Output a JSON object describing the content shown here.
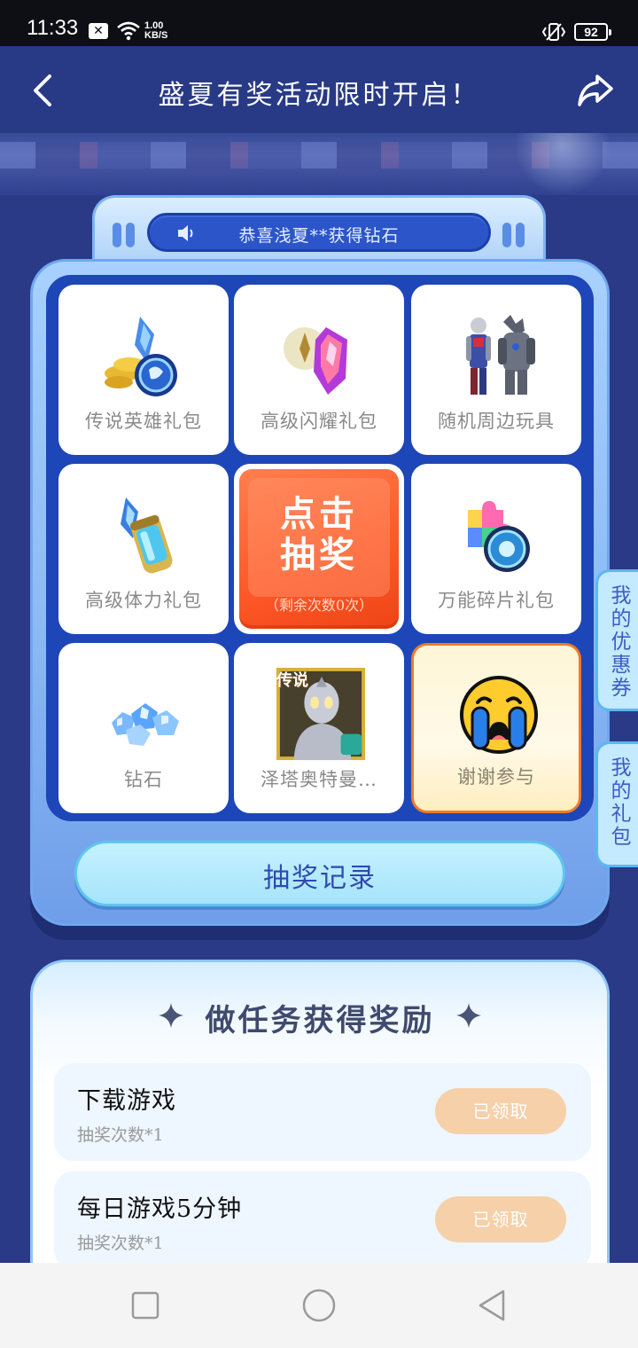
{
  "status_bar": {
    "time": "11:33",
    "net_speed_value": "1.00",
    "net_speed_unit": "KB/S",
    "battery": "92"
  },
  "header": {
    "title": "盛夏有奖活动限时开启！"
  },
  "notice": {
    "text": "恭喜浅夏**获得钻石"
  },
  "prizes": [
    {
      "label": "传说英雄礼包",
      "icon": "legend-hero-pack-icon"
    },
    {
      "label": "高级闪耀礼包",
      "icon": "shine-crystal-pack-icon"
    },
    {
      "label": "随机周边玩具",
      "icon": "figure-toys-icon"
    },
    {
      "label": "高级体力礼包",
      "icon": "energy-canister-icon"
    },
    {
      "label": "万能碎片礼包",
      "icon": "puzzle-fragment-icon"
    },
    {
      "label": "钻石",
      "icon": "diamond-pile-icon"
    },
    {
      "label": "泽塔奥特曼…",
      "icon": "zeta-ultraman-card-icon",
      "badge": "传说"
    },
    {
      "label": "谢谢参与",
      "icon": "crying-face-icon"
    }
  ],
  "draw_button": {
    "line1": "点击",
    "line2": "抽奖",
    "remaining": "（剩余次数0次）"
  },
  "records_button": {
    "label": "抽奖记录"
  },
  "side_tabs": {
    "coupons": "我的优惠券",
    "gifts": "我的礼包"
  },
  "tasks": {
    "title": "做任务获得奖励",
    "items": [
      {
        "name": "下载游戏",
        "reward": "抽奖次数*1",
        "status": "已领取"
      },
      {
        "name": "每日游戏5分钟",
        "reward": "抽奖次数*1",
        "status": "已领取"
      }
    ]
  },
  "colors": {
    "background": "#2a3a86",
    "accent": "#ff5a2a",
    "grid": "#1d46b8",
    "claimed": "#f6d0a8"
  }
}
